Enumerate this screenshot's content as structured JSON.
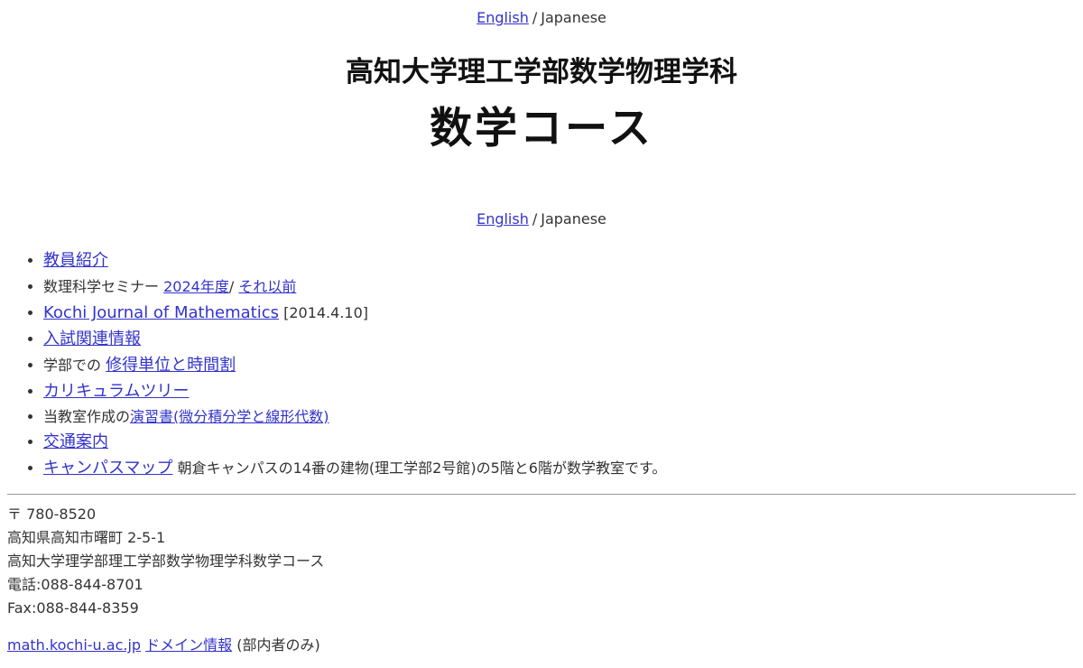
{
  "lang_bar": {
    "english_label": "English",
    "separator": "/",
    "current_label": "Japanese"
  },
  "header": {
    "title": "高知大学理工学部数学物理学科",
    "subtitle": "数学コース"
  },
  "menu": {
    "faculty": "教員紹介",
    "seminar_prefix": "数理科学セミナー",
    "seminar_current": "2024年度",
    "seminar_sep": "/",
    "seminar_past": "それ以前",
    "journal": "Kochi Journal of Mathematics",
    "journal_date": "[2014.4.10]",
    "admissions": "入試関連情報",
    "credits_prefix": "学部での",
    "credits_link": "修得単位と時間割",
    "curriculum": "カリキュラムツリー",
    "exercises_prefix": "当教室作成の",
    "exercises_link": "演習書(微分積分学と線形代数)",
    "access": "交通案内",
    "campus_map": "キャンパスマップ",
    "campus_note": "朝倉キャンパスの14番の建物(理工学部2号館)の5階と6階が数学教室です。"
  },
  "address": {
    "postal": "〒 780-8520",
    "city": "高知県高知市曙町 2-5-1",
    "department": "高知大学理学部理工学部数学物理学科数学コース",
    "phone": "電話:088-844-8701",
    "fax": "Fax:088-844-8359"
  },
  "domain_info": {
    "domain": "math.kochi-u.ac.jp",
    "link": "ドメイン情報",
    "note": "(部内者のみ)"
  },
  "colors": {
    "link": "#3333cc",
    "text": "#333333",
    "heading": "#111111",
    "divider": "#999999"
  }
}
